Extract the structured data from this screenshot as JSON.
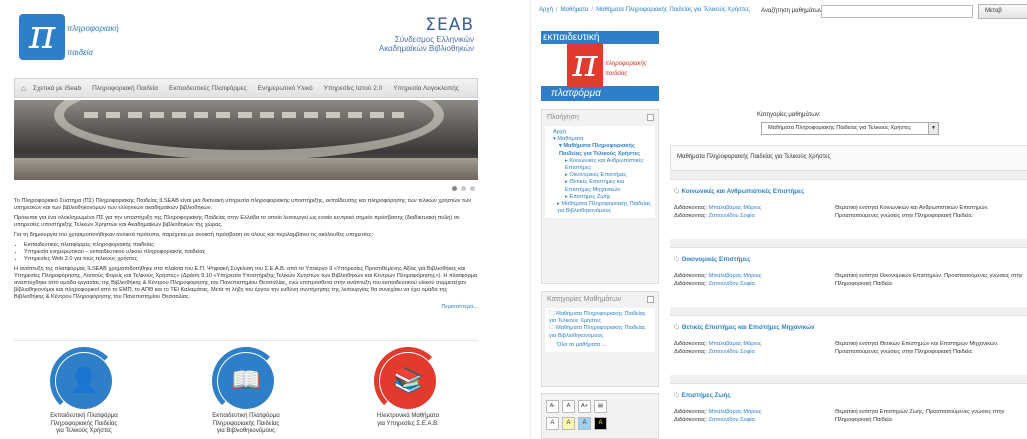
{
  "left": {
    "logo": {
      "word1": "πληροφοριακή",
      "word2": "παιδεία"
    },
    "seab": {
      "acronym": "ΣΕΑΒ",
      "line1": "Σύνδεσμος Ελληνικών",
      "line2": "Ακαδημαϊκών Βιβλιοθηκών"
    },
    "nav": {
      "home_icon": "home-icon",
      "items": [
        "Σχετικά με iSeab",
        "Πληροφοριακή Παιδεία",
        "Εκπαιδευτικές Πλατφόρμες",
        "Ενημερωτικό Υλικό",
        "Υπηρεσίες Ιστού 2.0",
        "Υπηρεσία Λογοκλοπής"
      ]
    },
    "intro": {
      "p1": "Το Πληροφοριακό Σύστημα (ΠΣ) Πληροφοριακής Παιδείας ILSEAB είναι μια δικτυακή υπηρεσία πληροφοριακής υποστήριξης, εκπαίδευσης και πληροφόρησης των τελικών χρηστών των υπηρεσιών και των βιβλιοθηκονόμων των ελληνικών ακαδημαϊκών βιβλιοθηκών.",
      "p2": "Πρόκειται για ένα ολοκληρωμένο ΠΣ για την υποστήριξη της Πληροφοριακής Παιδείας στην Ελλάδα το οποίο λειτουργεί ως ενιαίο κεντρικό σημείο πρόσβασης (διαδικτυακή πύλη) σε υπηρεσίες υποστήριξης Τελικών Χρηστών και Ακαδημαϊκών βιβλιοθηκών της χώρας.",
      "p3": "Για τη δημιουργία του χρησιμοποιήθηκαν ανοικτά πρότυπα, παρέχεται με ανοικτή πρόσβαση σε όλους και περιλαμβάνει τις ακόλουθες υπηρεσίες:",
      "bullets": [
        "Εκπαιδευτικές πλατφόρμες πληροφοριακής παιδείας",
        "Υπηρεσία ενημερωτικού – εκπαιδευτικού υλικού πληροφοριακής παιδείας",
        "Υπηρεσίες Web 2.0 για τους τελικούς χρήστες"
      ],
      "p4": "Η ανάπτυξη της πλατφόρμας ILSEAB χρηματοδοτήθηκε στα πλαίσια του Ε.Π. Ψηφιακή Σύγκλιση του Σ.Ε.Α.Β. από το Υποέργο 9 «Υπηρεσίες Προστιθέμενης Αξίας για Βιβλιοθήκες και Υπηρεσίες Πληροφόρησης, Λοιπούς Φορείς και Τελικούς Χρήστες» (Δράση 9.10 «Υπηρεσία Υποστήριξης Τελικών Χρηστών των Βιβλιοθηκών και Κέντρων Πληροφόρησης»). Η πλατφόρμα αναπτύχθηκε από ομάδα εργασίας της Βιβλιοθήκης & Κέντρου Πληροφόρησης του Πανεπιστημίου Θεσσαλίας, ενώ επιπρόσθετα στην ανάπτυξη του εκπαιδευτικού υλικού συμμετείχαν βιβλιοθηκονόμοι και πληροφορικοί από το ΕΜΠ, το ΑΠΘ και το ΤΕΙ Καλαμάτας. Μετά τη λήξη του έργου την ευθύνη συντήρησης της λειτουργίας θα συνεχίσει να έχει ομάδα της Βιβλιοθήκης & Κέντρου Πληροφόρησης του Πανεπιστημίου Θεσσαλίας.",
      "more": "Περισσότερα..."
    },
    "cards": [
      {
        "line1": "Εκπαιδευτική Πλατφόρμα",
        "line2": "Πληροφοριακής Παιδείας",
        "line3": "για Τελικούς Χρήστες",
        "color": "#2e7fc7",
        "icon": "user-icon"
      },
      {
        "line1": "Εκπαιδευτική Πλατφόρμα",
        "line2": "Πληροφοριακής Παιδείας",
        "line3": "για Βιβλιοθηκονόμους",
        "color": "#2e7fc7",
        "icon": "librarian-icon"
      },
      {
        "line1": "Ηλεκτρονικά Μαθήματα",
        "line2": "για Υπηρεσίες Σ.Ε.Α.Β.",
        "line3": "",
        "color": "#e23b2e",
        "icon": "book-icon"
      }
    ]
  },
  "right": {
    "breadcrumb": [
      "Αρχή",
      "Μαθήματα",
      "Μαθήματα Πληροφοριακής Παιδείας για Τελικούς Χρήστες"
    ],
    "search": {
      "label": "Αναζήτηση μαθημάτων:",
      "value": "",
      "button": "Μεταβ"
    },
    "logo": {
      "top": "εκπαιδευτική",
      "w1": "πληροφοριακής",
      "w2": "παιδείας",
      "bottom": "πλατφόρμα"
    },
    "nav_block": {
      "title": "Πλοήγηση",
      "items": [
        {
          "text": "Αρχή",
          "level": 1
        },
        {
          "text": "▾ Μαθήματα",
          "level": 1
        },
        {
          "text": "▾ Μαθήματα Πληροφοριακής Παιδείας για Τελικούς Χρήστες",
          "level": 2
        },
        {
          "text": "▸ Κοινωνικές και Ανθρωπιστικές Επιστήμες",
          "level": 3
        },
        {
          "text": "▸ Οικονομικές Επιστήμες",
          "level": 3
        },
        {
          "text": "▸ Θετικές Επιστήμες και Επιστήμες Μηχανικών",
          "level": 3
        },
        {
          "text": "▸ Επιστήμες Ζωής",
          "level": 3
        },
        {
          "text": "▸ Μαθήματα Πληροφοριακής Παιδείας για Βιβλιοθηκονόμους",
          "level": 2
        }
      ]
    },
    "categories_block": {
      "title": "Κατηγορίες Μαθημάτων",
      "items": [
        "Μαθήματα Πληροφοριακής Παιδείας για Τελικούς Χρήστες",
        "Μαθήματα Πληροφοριακής Παιδείας για Βιβλιοθηκονόμους"
      ],
      "all": "Όλα τα μαθήματα ..."
    },
    "accessibility": {
      "sizes": [
        "A-",
        "A",
        "A+"
      ],
      "colors": [
        "A",
        "A",
        "A",
        "A"
      ]
    },
    "main": {
      "category_label": "Κατηγορίες μαθημάτων:",
      "category_select": "Μαθήματα Πληροφοριακής Παιδείας για Τελικούς Χρήστες",
      "category_heading": "Μαθήματα Πληροφοριακής Παιδείας για Τελικούς Χρήστες",
      "teacher_label": "Διδάσκοντας:",
      "courses": [
        {
          "title": "Κοινωνικές και Ανθρωπιστικές Επιστήμες",
          "t1": "Μπαλαβάρας Μάριος",
          "t2": "Ζαπουνίδου Σοφία",
          "summary": "Θεματική ενότητα Κοινωνικών και Ανθρωπιστικών Επιστημών. Προαπαιτούμενες γνώσεις στην Πληροφοριακή Παιδεία."
        },
        {
          "title": "Οικονομικές Επιστήμες",
          "t1": "Μπαλαβάρας Μάριος",
          "t2": "Ζαπουνίδου Σοφία",
          "summary": "Θεματική ενότητα Οικονομικών Επιστημών. Προαπαιτούμενες γνώσεις στην Πληροφοριακή Παιδεία."
        },
        {
          "title": "Θετικές Επιστήμες και Επιστήμες Μηχανικών",
          "t1": "Μπαλαβάρας Μάριος",
          "t2": "Ζαπουνίδου Σοφία",
          "summary": "Θεματική ενότητα Θετικών Επιστημών και Επιστημών Μηχανικών. Προαπαιτούμενες γνώσεις στην Πληροφοριακή Παιδεία."
        },
        {
          "title": "Επιστήμες Ζωής",
          "t1": "Μπαλαβάρας Μάριος",
          "t2": "Ζαπουνίδου Σοφία",
          "summary": "Θεματική ενότητα Επιστημών Ζωής. Προαπαιτούμενες γνώσεις στην Πληροφοριακή Παιδεία."
        }
      ]
    }
  }
}
